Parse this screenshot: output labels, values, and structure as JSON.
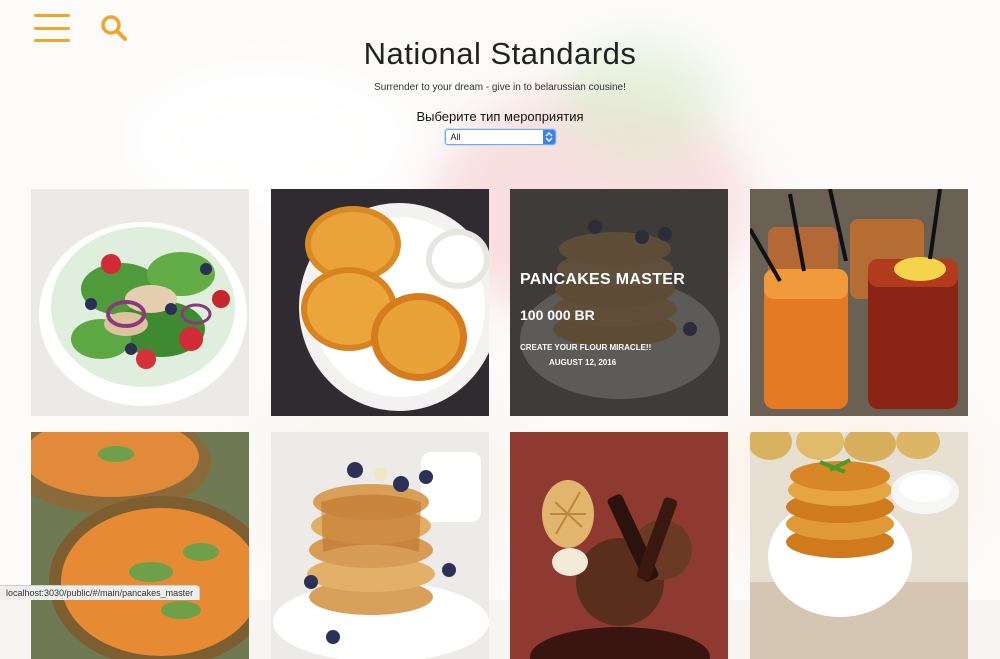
{
  "header": {
    "title": "National Standards",
    "subtitle": "Surrender to your dream - give in to belarussian cousine!",
    "filter_label": "Выберите тип мероприятия",
    "filter_selected": "All"
  },
  "icons": {
    "menu": "hamburger-icon",
    "search": "search-icon",
    "select_caret": "chevron-updown-icon"
  },
  "colors": {
    "accent": "#f0a62b",
    "select_blue": "#3b82e6",
    "overlay": "#2d2d2d"
  },
  "tiles": [
    {
      "image": "salad"
    },
    {
      "image": "potato-pancakes-sour-cream"
    },
    {
      "image": "pancakes-stack",
      "overlay": {
        "title": "PANCAKES MASTER",
        "price": "100 000 BR",
        "description": "CREATE YOUR FLOUR MIRACLE!!",
        "date": "AUGUST 12, 2016"
      }
    },
    {
      "image": "iced-tea-drinks"
    },
    {
      "image": "soup-bowls"
    },
    {
      "image": "blueberry-pancakes"
    },
    {
      "image": "chocolate-ice-cream"
    },
    {
      "image": "draniki-stack"
    }
  ],
  "status_url": "localhost:3030/public/#/main/pancakes_master"
}
